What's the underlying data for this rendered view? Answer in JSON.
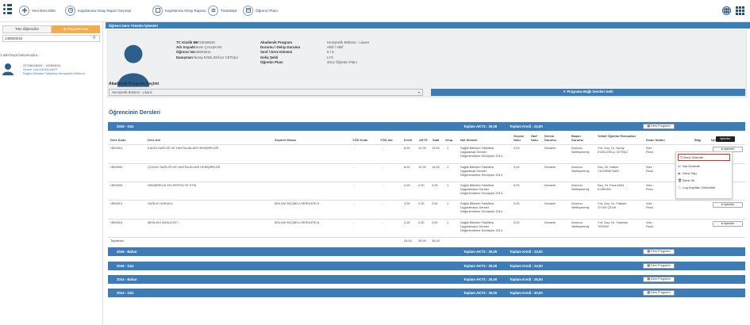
{
  "toolbar": {
    "buttons": [
      "Yeni Ders Ekle",
      "Kayıtlanma Onay Rapor Geçmişi",
      "Kayıtlanma Onay Raporu",
      "Transkript",
      "Öğrenci Planı"
    ]
  },
  "sidebar": {
    "tab_all": "Tüm Öğrenciler",
    "tab_program": "Programı Seç",
    "search_value": "140603016",
    "result_count": "1 adet kayıt bulunmuştur...",
    "result": {
      "line1": "22708048026 - 140603011",
      "line2": "Sinem ÇALIŞKAN AKET",
      "line3": "Sağlık Bilimleri Fakültesi Hemşirelik Bölümü"
    }
  },
  "header": {
    "title": "Öğrenci Ders Yönetim İşlemleri"
  },
  "profile": {
    "labels_left": [
      "TC Kimlik No",
      "Adı Soyadı",
      "Öğrenci No",
      "Danışman"
    ],
    "values_left": [
      "22723048026",
      "Sinem ÇALIŞKAN",
      "140603011",
      "Nuray EGELİOĞLU CETİŞLİ"
    ],
    "labels_right": [
      "Akademik Program",
      "Durumu / Delay Durumu",
      "Sınıf / Ders Dönemi",
      "Geliş Şekli",
      "Öğretim Planı"
    ],
    "values_right": [
      "Hemşirelik Bölümü - Lisans",
      "Aktif / Aktif",
      "5 / 8",
      "LYS",
      "2012 Öğretim Planı"
    ]
  },
  "program_select": {
    "label": "Akademik Program Seçimi",
    "selected": "Hemşirelik Bölümü - Lisans",
    "button": "Programa Bağlı Dersleri Getir"
  },
  "courses_title": "Öğrencinin Dersleri",
  "terms": [
    {
      "name": "2015 - Güz",
      "akts": "Toplam AKTS : 30,00",
      "kredi": "Toplam Kredi : 24,00",
      "btn": "Ders Programı"
    },
    {
      "name": "2016 - Bahar",
      "akts": "Toplam AKTS : 30,00",
      "kredi": "Toplam Kredi : 23,00",
      "btn": "Ders Programı"
    },
    {
      "name": "2016 - Güz",
      "akts": "Toplam AKTS : 30,00",
      "kredi": "Toplam Kredi : 24,00",
      "btn": "Ders Programı"
    },
    {
      "name": "2014 - Bahar",
      "akts": "Toplam AKTS : 30,00",
      "kredi": "Toplam Kredi : 26,00",
      "btn": "Ders Programı"
    },
    {
      "name": "2014 - Güz",
      "akts": "Toplam AKTS : 30,00",
      "kredi": "Toplam Kredi : 30,00",
      "btn": "Ders Programı"
    }
  ],
  "columns": [
    "Ders Kodu",
    "Ders Adı",
    "Seçmeli Havuz",
    "YÖD Kodu",
    "YÖD Adı",
    "Kredi",
    "AKTS",
    "Saat",
    "Grup",
    "Not Sistemi",
    "Geçme Notu",
    "Harf Notu",
    "Dersin Durumu",
    "Başarı Durumu",
    "Yetkili Öğretim Elemanları",
    "Sınav Notları",
    "Bilgi",
    "İşlemler"
  ],
  "rows": [
    {
      "code": "HEM301",
      "name": "KADIN SAĞLIĞI VE HASTALIKLARI HEMŞİRELİĞİ",
      "pool": "",
      "yod": "-",
      "yodad": "-",
      "kredi": "8,00",
      "akts": "12,00",
      "saat": "13,00",
      "grup": "1",
      "notsis1": "Sağlık Bilimleri Fakültesi",
      "notsis2": "Uygulamalı Dersler",
      "notsis3": "Değerlendirme Dönüşüm 2014",
      "gecme": "0,00",
      "harf": "",
      "durum": "Devamlı",
      "basari": "Durumu",
      "basari2": "Netleşmemiş",
      "ogr1": "Yrd. Doç. Dr. Nuray",
      "ogr2": "EGELİOĞLU CETİŞLİ",
      "sinav1": "Vize :",
      "sinav2": "Final :"
    },
    {
      "code": "HEM300",
      "name": "ÇOCUK SAĞLIĞI VE HASTALIKLARI HEMŞİRELİĞİ",
      "pool": "",
      "yod": "-",
      "yodad": "-",
      "kredi": "8,00",
      "akts": "12,00",
      "saat": "14,00",
      "grup": "1",
      "notsis1": "Sağlık Bilimleri Fakültesi",
      "notsis2": "Uygulamalı Dersler",
      "notsis3": "Değerlendirme Dönüşüm 2014",
      "gecme": "0,00",
      "harf": "",
      "durum": "Devamlı",
      "basari": "Durumu",
      "basari2": "Netleşmemiş",
      "ogr1": "Doç. Dr. Hatice",
      "ogr2": "YILDIRIM SARI",
      "sinav1": "Vize :",
      "sinav2": "Final :"
    },
    {
      "code": "HEM305",
      "name": "HEMŞİRELİK FELSEFESİ VE ETİK",
      "pool": "",
      "yod": "-",
      "yodad": "-",
      "kredi": "2,00",
      "akts": "2,00",
      "saat": "2,00",
      "grup": "1",
      "notsis1": "Sağlık Bilimleri Fakültesi",
      "notsis2": "Uygulamasız Dersler",
      "notsis3": "Değerlendirme Dönüşüm 2014",
      "gecme": "0,00",
      "harf": "",
      "durum": "Devamlı",
      "basari": "Durumu",
      "basari2": "Netleşmemiş",
      "ogr1": "Doç. Dr. Esra AKIN",
      "ogr2": "KORHAN",
      "sinav1": "Vize :",
      "sinav2": "Final :"
    },
    {
      "code": "HEM313",
      "name": "SAĞLIK HUKUKU",
      "pool": "BÖLÜM SEÇMELİ DERSLERİ-5",
      "yod": "-",
      "yodad": "-",
      "kredi": "2,00",
      "akts": "2,00",
      "saat": "2,00",
      "grup": "1",
      "notsis1": "Sağlık Bilimleri Fakültesi",
      "notsis2": "Uygulamasız Dersler",
      "notsis3": "Değerlendirme Dönüşüm 2014",
      "gecme": "0,00",
      "harf": "",
      "durum": "Devamlı",
      "basari": "Durumu",
      "basari2": "Netleşmemiş",
      "ogr1": "Yrd. Doç. Dr. Fadime",
      "ogr2": "OYUR ÇELİK",
      "sinav1": "Vize :",
      "sinav2": "Final :"
    },
    {
      "code": "HEM315",
      "name": "MESLEKİ İNGİLİZCE I",
      "pool": "BÖLÜM SEÇMELİ DERSLERİ-6",
      "yod": "-",
      "yodad": "-",
      "kredi": "2,00",
      "akts": "2,00",
      "saat": "2,00",
      "grup": "1",
      "notsis1": "Sağlık Bilimleri Fakültesi",
      "notsis2": "Uygulamasız Dersler",
      "notsis3": "Değerlendirme Dönüşüm 2014",
      "gecme": "0,00",
      "harf": "",
      "durum": "Devamlı",
      "basari": "Durumu",
      "basari2": "Netleşmemiş",
      "ogr1": "Yrd. Doç. Dr. Yasemin",
      "ogr2": "TOKEM",
      "sinav1": "Vize :",
      "sinav2": "Final :"
    }
  ],
  "totals": {
    "label": "Toplamlar",
    "kredi": "24,00",
    "akts": "30,00",
    "saat": "33,00"
  },
  "action_button": "İşlemler",
  "tooltip": "İşlemler",
  "menu": [
    "Dersi Düzenle",
    "Not Düzenle",
    "Dersi Taşı",
    "Dersi Sil",
    "Log Kayıtları Görüntüle"
  ],
  "colors": {
    "accent": "#3e7cb5",
    "button_orange": "#f0ad4e",
    "highlight": "#c9302c"
  }
}
